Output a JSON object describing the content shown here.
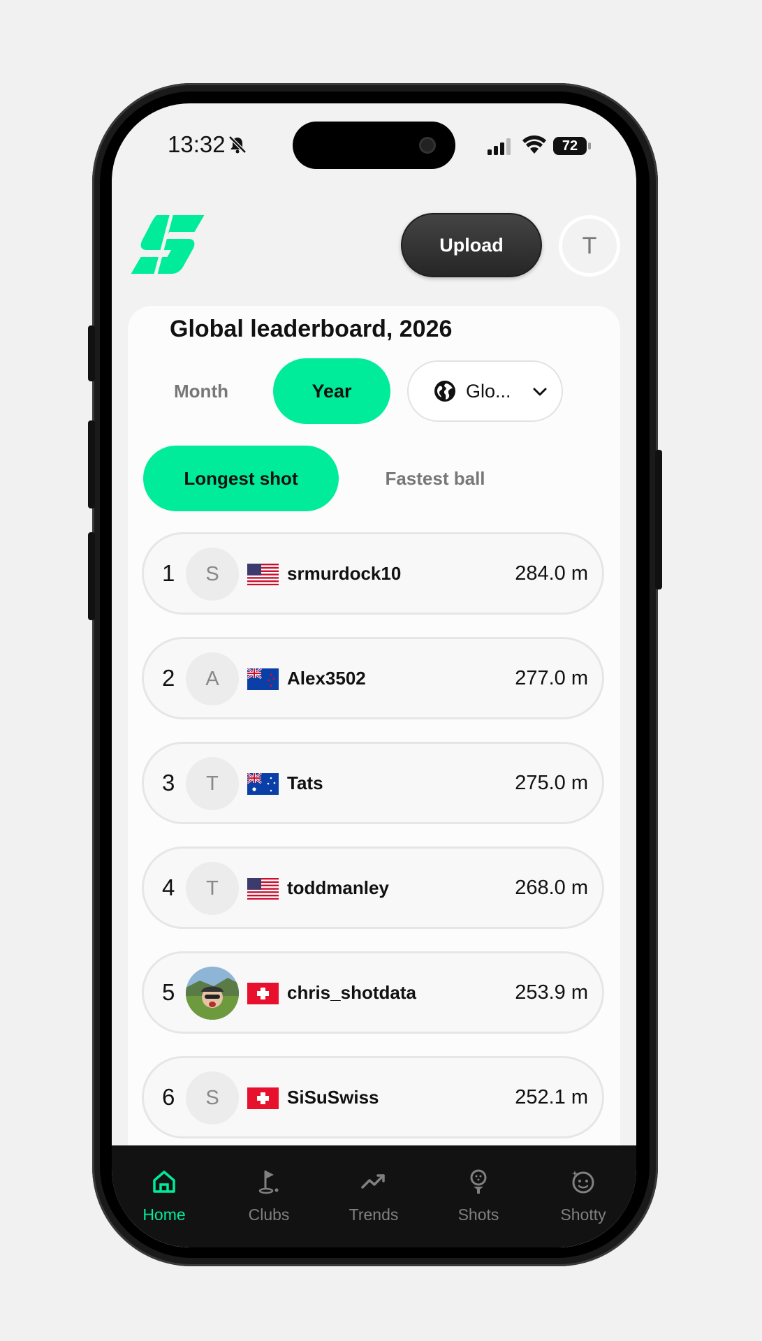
{
  "status_bar": {
    "time": "13:32",
    "battery": "72"
  },
  "header": {
    "upload_label": "Upload",
    "avatar_initial": "T"
  },
  "leaderboard": {
    "title": "Global leaderboard, 2026",
    "period_tabs": [
      {
        "label": "Month",
        "selected": false
      },
      {
        "label": "Year",
        "selected": true
      }
    ],
    "region": "Glo...",
    "metric_tabs": [
      {
        "label": "Longest shot",
        "selected": true
      },
      {
        "label": "Fastest ball",
        "selected": false
      }
    ],
    "rows": [
      {
        "rank": "1",
        "initial": "S",
        "country": "US",
        "name": "srmurdock10",
        "value": "284.0 m"
      },
      {
        "rank": "2",
        "initial": "A",
        "country": "NZ",
        "name": "Alex3502",
        "value": "277.0 m"
      },
      {
        "rank": "3",
        "initial": "T",
        "country": "AU",
        "name": "Tats",
        "value": "275.0 m"
      },
      {
        "rank": "4",
        "initial": "T",
        "country": "US",
        "name": "toddmanley",
        "value": "268.0 m"
      },
      {
        "rank": "5",
        "initial": "",
        "country": "CH",
        "name": "chris_shotdata",
        "value": "253.9 m",
        "has_photo": true
      },
      {
        "rank": "6",
        "initial": "S",
        "country": "CH",
        "name": "SiSuSwiss",
        "value": "252.1 m"
      }
    ]
  },
  "nav": {
    "items": [
      {
        "label": "Home",
        "icon": "home-icon",
        "active": true
      },
      {
        "label": "Clubs",
        "icon": "golf-flag-icon",
        "active": false
      },
      {
        "label": "Trends",
        "icon": "trend-icon",
        "active": false
      },
      {
        "label": "Shots",
        "icon": "golf-ball-tee-icon",
        "active": false
      },
      {
        "label": "Shotty",
        "icon": "shotty-face-icon",
        "active": false
      }
    ]
  },
  "colors": {
    "accent": "#00ec9a",
    "nav_bg": "#121212",
    "background": "#f1f1f1"
  }
}
